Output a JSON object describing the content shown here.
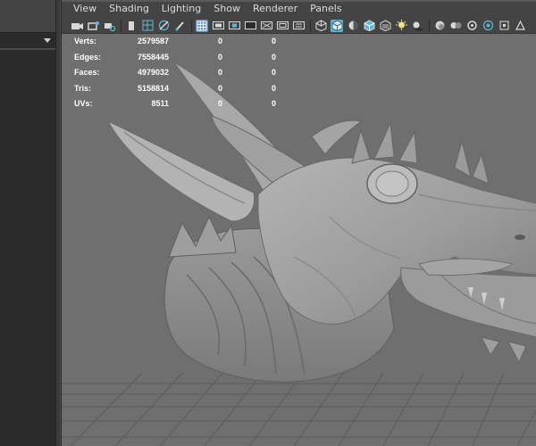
{
  "viewport": {
    "menu": [
      "View",
      "Shading",
      "Lighting",
      "Show",
      "Renderer",
      "Panels"
    ]
  },
  "toolbar": {
    "icons": [
      "camera-icon",
      "camera-attributes-icon",
      "bookmarks-icon",
      "image-plane-icon",
      "grid-toggle-icon",
      "film-gate-icon",
      "resolution-gate-icon",
      "safe-action-icon",
      "field-chart-icon",
      "wireframe-icon",
      "smooth-shade-icon",
      "textured-icon",
      "lights-icon",
      "shadows-icon",
      "ambient-occlusion-icon",
      "isolate-select-icon",
      "xray-icon",
      "backface-culling-icon"
    ]
  },
  "hud": {
    "rows": [
      {
        "label": "Verts:",
        "total": "2579587",
        "selected": "0",
        "components": "0"
      },
      {
        "label": "Edges:",
        "total": "7558445",
        "selected": "0",
        "components": "0"
      },
      {
        "label": "Faces:",
        "total": "4979032",
        "selected": "0",
        "components": "0"
      },
      {
        "label": "Tris:",
        "total": "5158814",
        "selected": "0",
        "components": "0"
      },
      {
        "label": "UVs:",
        "total": "8511",
        "selected": "0",
        "components": "0"
      }
    ]
  },
  "colors": {
    "viewport_bg": "#6f6f6f",
    "panel_bg": "#444444",
    "model_gray": "#a6a6a6",
    "grid_line": "#5a5a5a",
    "active_toggle": "#5fb7d7"
  }
}
